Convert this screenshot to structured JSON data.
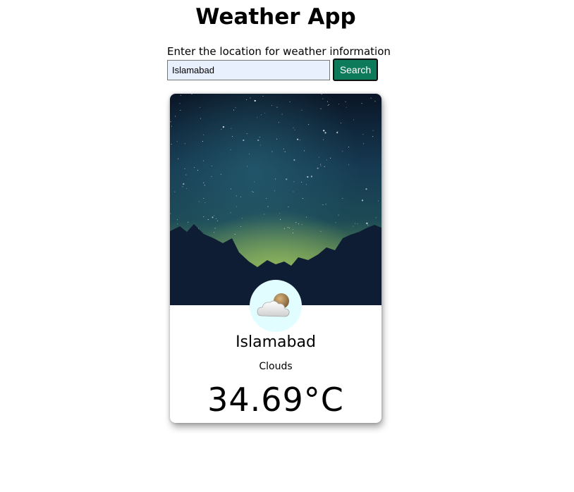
{
  "header": {
    "title": "Weather App"
  },
  "search": {
    "label": "Enter the location for weather information",
    "value": "Islamabad",
    "button_label": "Search"
  },
  "weather_card": {
    "background": "night-sky-mountains",
    "icon": "cloud-sun-icon",
    "city": "Islamabad",
    "condition": "Clouds",
    "temperature": "34.69°C"
  },
  "colors": {
    "button_bg": "#0d7a5a",
    "input_bg": "#e8f0fe",
    "icon_circle": "#e2fdff",
    "sky_top": "#0b1a2e",
    "sky_mid": "#1f4a5c",
    "horizon_glow": "#7ea85a",
    "mountains": "#0e1e33"
  }
}
